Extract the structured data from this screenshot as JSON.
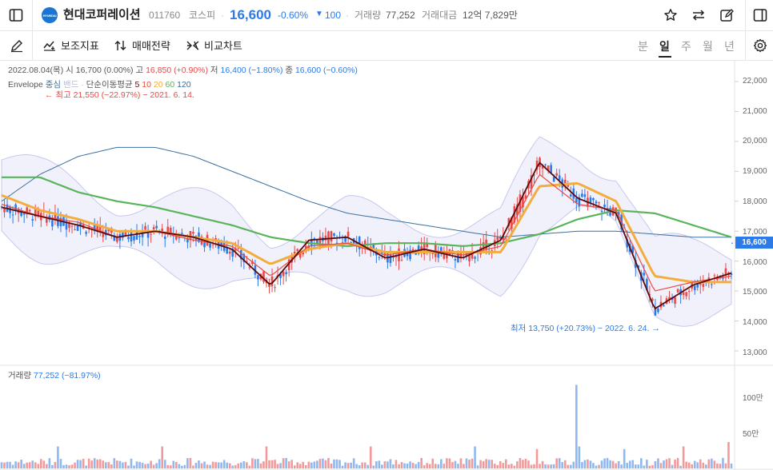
{
  "header": {
    "stock_name": "현대코퍼레이션",
    "code": "011760",
    "market": "코스피",
    "price": "16,600",
    "change_pct": "-0.60%",
    "change_arrow": "▼",
    "change_amount": "100",
    "volume_label": "거래량",
    "volume_value": "77,252",
    "value_label": "거래대금",
    "value_value": "12억 7,829만",
    "logo_text": "HYUNDAI"
  },
  "toolbar": {
    "indicators_label": "보조지표",
    "strategy_label": "매매전략",
    "compare_label": "비교차트",
    "periods": [
      "분",
      "일",
      "주",
      "월",
      "년"
    ],
    "active_period": "일"
  },
  "info_line": {
    "date": "2022.08.04(목)",
    "open_label": "시",
    "open_value": "16,700 (0.00%)",
    "high_label": "고",
    "high_value": "16,850 (+0.90%)",
    "low_label": "저",
    "low_value": "16,400 (−1.80%)",
    "close_label": "종",
    "close_value": "16,600 (−0.60%)"
  },
  "indicator_line": {
    "envelope": "Envelope",
    "center": "중심",
    "band": "밴드",
    "sma_label": "단순이동평균",
    "periods": [
      "5",
      "10",
      "20",
      "60",
      "120"
    ]
  },
  "annotations": {
    "max_text": "← 최고 21,550 (−22.97%) − 2021. 6. 14.",
    "min_text": "최저 13,750 (+20.73%) − 2022. 6. 24. →"
  },
  "price_axis": [
    "22,000",
    "21,000",
    "20,000",
    "19,000",
    "18,000",
    "17,000",
    "16,000",
    "15,000",
    "14,000",
    "13,000"
  ],
  "current_price_tag": "16,600",
  "volume_panel": {
    "label": "거래량",
    "value": "77,252 (−81.97%)",
    "axis": [
      "100만",
      "50만"
    ]
  },
  "colors": {
    "up": "#e84a4a",
    "down": "#2c7ae8",
    "ma5": "#5c0a0a",
    "ma10": "#ea4b3c",
    "ma20": "#f2ad3c",
    "ma60": "#59b45c",
    "ma120": "#3a6f9f",
    "band": "#c7c7ee",
    "band_fill": "#f1f1fc",
    "accent": "#1a76d2"
  },
  "chart_data": {
    "type": "candlestick",
    "series": [
      {
        "name": "5",
        "values_approx": [
          17800,
          17500,
          17200,
          16800,
          17000,
          16800,
          16400,
          15200,
          16700,
          16800,
          16100,
          16400,
          16100,
          16700,
          19300,
          18100,
          17600,
          14400,
          15200,
          15600
        ]
      },
      {
        "name": "10",
        "values_approx": [
          17900,
          17500,
          17300,
          16800,
          17000,
          16700,
          16500,
          15500,
          16500,
          16600,
          16200,
          16400,
          16200,
          16500,
          18900,
          17900,
          17700,
          15000,
          15300,
          15500
        ]
      },
      {
        "name": "20",
        "values_approx": [
          18200,
          17700,
          17400,
          17000,
          17000,
          16800,
          16600,
          15900,
          16400,
          16600,
          16300,
          16300,
          16300,
          16300,
          18500,
          18600,
          18000,
          15500,
          15300,
          15300
        ]
      },
      {
        "name": "60",
        "values_approx": [
          18800,
          18800,
          18300,
          18000,
          17800,
          17500,
          17200,
          16800,
          16600,
          16500,
          16600,
          16600,
          16500,
          16600,
          16900,
          17400,
          17700,
          17600,
          17200,
          16800
        ]
      },
      {
        "name": "120",
        "values_approx": [
          18000,
          18900,
          19500,
          19800,
          19800,
          19500,
          19000,
          18500,
          18000,
          17600,
          17400,
          17200,
          17000,
          16800,
          16900,
          17000,
          17000,
          16900,
          16800,
          16800
        ]
      }
    ],
    "y_range": [
      13000,
      22000
    ],
    "max": {
      "value": 21550,
      "date": "2021. 6. 14."
    },
    "min": {
      "value": 13750,
      "date": "2022. 6. 24."
    },
    "last_close": 16600
  }
}
